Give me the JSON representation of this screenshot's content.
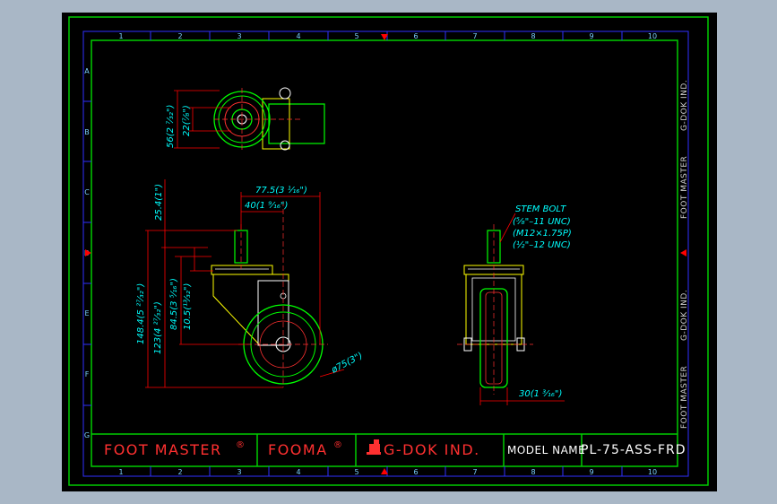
{
  "colors": {
    "background": "#a9b7c6",
    "canvas": "#000000",
    "frame": "#00cc00",
    "dimension": "#ff0000",
    "annotation": "#00ffff",
    "title_red": "#ff3030",
    "model_text": "#ffffff",
    "outline": "#ffffff",
    "wheel": "#00ff00",
    "bracket": "#ffff00",
    "zone_label": "#7ad0ff"
  },
  "border": {
    "top_numbers": [
      "1",
      "2",
      "3",
      "4",
      "5",
      "6",
      "7",
      "8",
      "9",
      "10"
    ],
    "bottom_numbers": [
      "1",
      "2",
      "3",
      "4",
      "5",
      "6",
      "7",
      "8",
      "9",
      "10"
    ],
    "side_letters": [
      "A",
      "B",
      "C",
      "D",
      "E",
      "F",
      "G"
    ]
  },
  "side_labels": [
    "G-DOK IND.",
    "FOOT MASTER",
    "G-DOK IND.",
    "FOOT MASTER"
  ],
  "dimensions": {
    "top_view_overall": "56(2 ⁷⁄₃₂\")",
    "top_view_inner": "22(⁷⁄₈\")",
    "front_top_stem": "25.4(1\")",
    "front_offset_wide": "77.5(3 ¹⁄₁₆\")",
    "front_offset_narrow": "40(1 ⁹⁄₁₆\")",
    "front_total_height": "148.4(5 ²⁷⁄₃₂\")",
    "front_body_height": "123(4 ²⁷⁄₃₂\")",
    "front_mid_height": "84.5(3 ⁵⁄₁₆\")",
    "front_axle_height": "10.5(¹³⁄₃₂\")",
    "wheel_diameter": "ø75(3\")",
    "side_wheel_width": "30(1 ³⁄₁₆\")"
  },
  "stem_bolt": {
    "title": "STEM BOLT",
    "lines": [
      "(⁵⁄₈\"–11 UNC)",
      "(M12×1.75P)",
      "(½\"–12 UNC)"
    ]
  },
  "title_block": {
    "brand1": "FOOT MASTER",
    "brand2": "FOOMA",
    "registered": "®",
    "brand3": "G-DOK IND.",
    "model_label": "MODEL NAME",
    "model_value": "PL-75-ASS-FRD"
  }
}
